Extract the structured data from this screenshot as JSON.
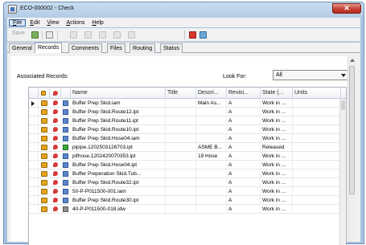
{
  "window": {
    "title": "ECO-000002 - Check",
    "close_label": "✕"
  },
  "menu": [
    {
      "underline": "F",
      "rest": "ile"
    },
    {
      "underline": "E",
      "rest": "dit"
    },
    {
      "underline": "V",
      "rest": "iew"
    },
    {
      "underline": "A",
      "rest": "ctions"
    },
    {
      "underline": "H",
      "rest": "elp"
    }
  ],
  "toolbar": {
    "save_label": "Save"
  },
  "tabs": [
    "General",
    "Records",
    "Comments",
    "Files",
    "Routing",
    "Status"
  ],
  "records": {
    "associated_label": "Associated Records:",
    "look_for_label": "Look For:",
    "look_for_value": "All",
    "columns": [
      "Name",
      "Title",
      "Descri...",
      "Revisi...",
      "State (...",
      "Units"
    ],
    "rows": [
      {
        "name": "Buffer Prep Skid.iam",
        "title": "",
        "desc": "Main As...",
        "rev": "A",
        "state": "Work in ...",
        "units": "",
        "color": "blue",
        "pointer": true
      },
      {
        "name": "Buffer Prep Skid.Route12.ipt",
        "title": "",
        "desc": "",
        "rev": "A",
        "state": "Work in ...",
        "units": "",
        "color": "blue"
      },
      {
        "name": "Buffer Prep Skid.Route11.ipt",
        "title": "",
        "desc": "",
        "rev": "A",
        "state": "Work in ...",
        "units": "",
        "color": "blue"
      },
      {
        "name": "Buffer Prep Skid.Route10.ipt",
        "title": "",
        "desc": "",
        "rev": "A",
        "state": "Work in ...",
        "units": "",
        "color": "blue"
      },
      {
        "name": "Buffer Prep Skid.Hose04.iam",
        "title": "",
        "desc": "",
        "rev": "A",
        "state": "Work in ...",
        "units": "",
        "color": "blue"
      },
      {
        "name": "pipipe.1202503126703.ipt",
        "title": "",
        "desc": "ASME B...",
        "rev": "A",
        "state": "Released",
        "units": "",
        "color": "green"
      },
      {
        "name": "pifhose.1202420070353.ipt",
        "title": "",
        "desc": "19 Hose",
        "rev": "A",
        "state": "Work in ...",
        "units": "",
        "color": "blue"
      },
      {
        "name": "Buffer Prep Skid.Hose04.ipt",
        "title": "",
        "desc": "",
        "rev": "A",
        "state": "Work in ...",
        "units": "",
        "color": "blue"
      },
      {
        "name": "Buffer Preperation Skid.Tub...",
        "title": "",
        "desc": "",
        "rev": "A",
        "state": "Work in ...",
        "units": "",
        "color": "blue"
      },
      {
        "name": "Buffer Prep Skid.Route32.ipt",
        "title": "",
        "desc": "",
        "rev": "A",
        "state": "Work in ...",
        "units": "",
        "color": "blue"
      },
      {
        "name": "50-P-P011500-001.iam",
        "title": "",
        "desc": "",
        "rev": "A",
        "state": "Work in ...",
        "units": "",
        "color": "blue"
      },
      {
        "name": "Buffer Prep Skid.Route30.ipt",
        "title": "",
        "desc": "",
        "rev": "A",
        "state": "Work in ...",
        "units": "",
        "color": "blue"
      },
      {
        "name": "40-P-P011500-018.idw",
        "title": "",
        "desc": "",
        "rev": "A",
        "state": "Work in ...",
        "units": "",
        "color": "gray"
      }
    ]
  }
}
